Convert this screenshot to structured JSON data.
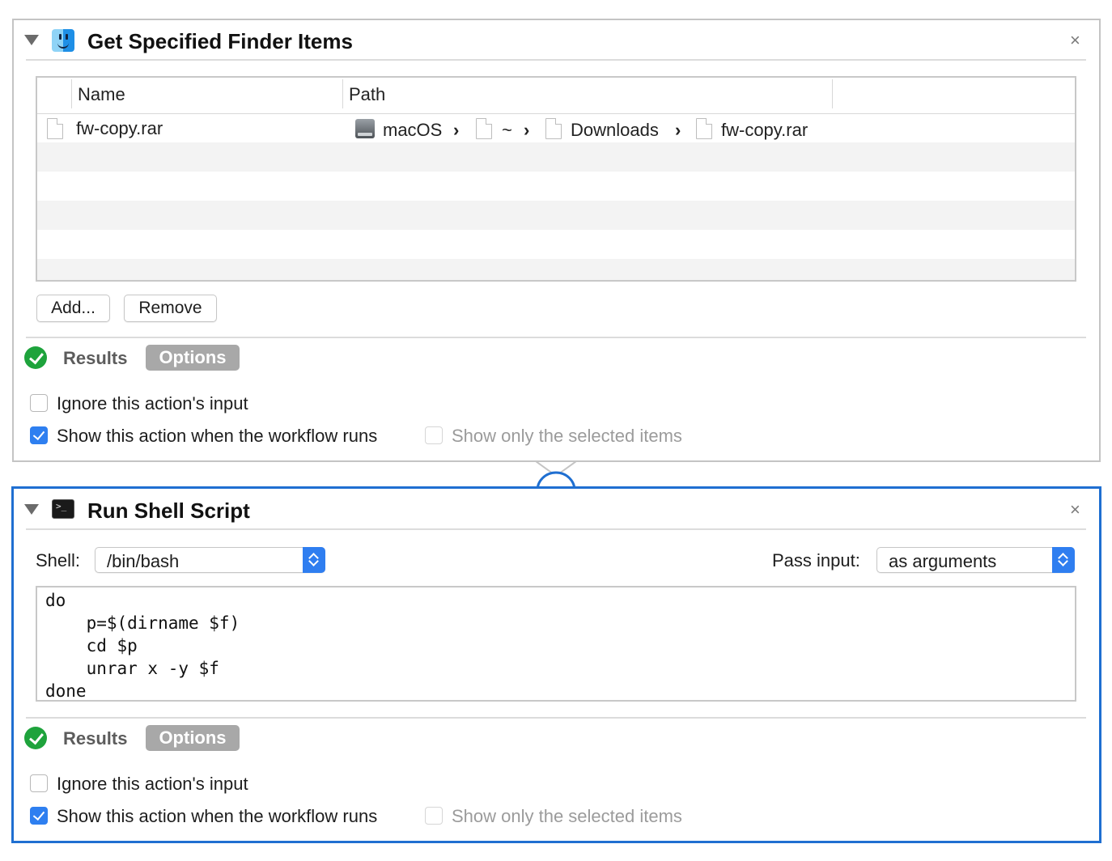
{
  "action1": {
    "title": "Get Specified Finder Items",
    "icon": "finder-icon",
    "close_glyph": "×",
    "table": {
      "columns": [
        "Name",
        "Path"
      ],
      "rows": [
        {
          "name": "fw-copy.rar",
          "path": [
            "macOS",
            "~",
            "Downloads",
            "fw-copy.rar"
          ]
        }
      ]
    },
    "buttons": {
      "add": "Add...",
      "remove": "Remove"
    },
    "tabs": {
      "results": "Results",
      "options": "Options"
    },
    "options": {
      "ignore_input": {
        "label": "Ignore this action's input",
        "checked": false
      },
      "show_when_runs": {
        "label": "Show this action when the workflow runs",
        "checked": true
      },
      "show_only_selected": {
        "label": "Show only the selected items",
        "checked": false,
        "enabled": false
      }
    }
  },
  "action2": {
    "title": "Run Shell Script",
    "icon": "terminal-icon",
    "close_glyph": "×",
    "shell_label": "Shell:",
    "shell_value": "/bin/bash",
    "pass_input_label": "Pass input:",
    "pass_input_value": "as arguments",
    "script": "do\n    p=$(dirname $f)\n    cd $p\n    unrar x -y $f\ndone",
    "tabs": {
      "results": "Results",
      "options": "Options"
    },
    "options": {
      "ignore_input": {
        "label": "Ignore this action's input",
        "checked": false
      },
      "show_when_runs": {
        "label": "Show this action when the workflow runs",
        "checked": true
      },
      "show_only_selected": {
        "label": "Show only the selected items",
        "checked": false,
        "enabled": false
      }
    }
  },
  "colors": {
    "selected_border": "#1f6fd1",
    "accent": "#2e7ff0",
    "success": "#1ea33c",
    "options_pill": "#a8a8a8"
  }
}
